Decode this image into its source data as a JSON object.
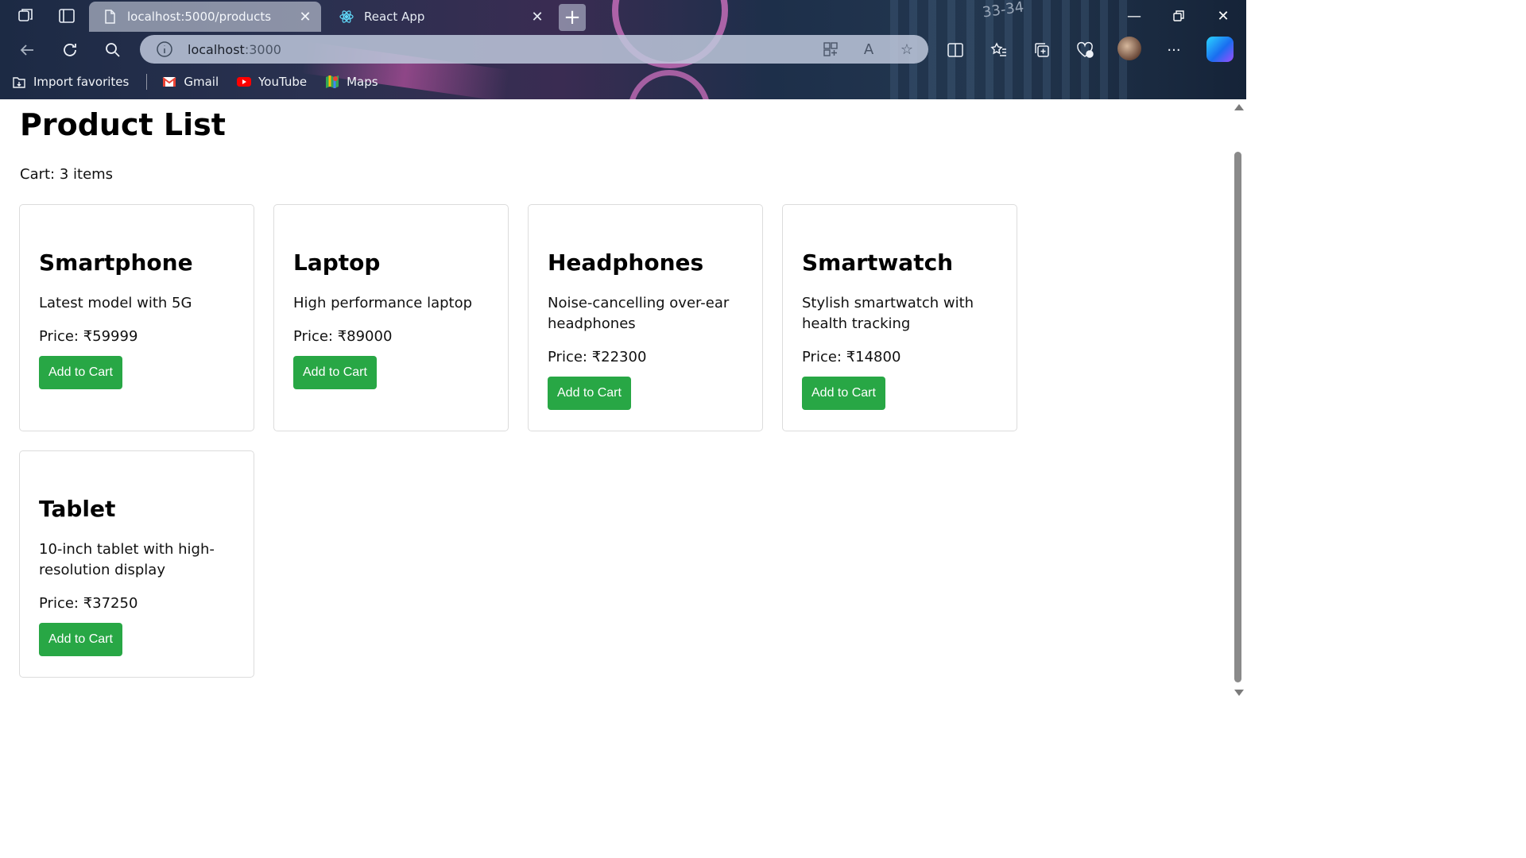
{
  "browser": {
    "tabs": [
      {
        "title": "localhost:5000/products",
        "active": true,
        "icon": "page-icon"
      },
      {
        "title": "React App",
        "active": false,
        "icon": "react-icon"
      }
    ],
    "address_url_host": "localhost",
    "address_url_port": ":3000",
    "bookmarks": [
      {
        "label": "Import favorites",
        "icon": "import-favorites-icon"
      },
      {
        "label": "Gmail",
        "icon": "gmail-icon"
      },
      {
        "label": "YouTube",
        "icon": "youtube-icon"
      },
      {
        "label": "Maps",
        "icon": "maps-icon"
      }
    ],
    "wallpaper_text": "33-34"
  },
  "page": {
    "title": "Product List",
    "cart_text": "Cart: 3 items",
    "products": [
      {
        "name": "Smartphone",
        "description": "Latest model with 5G",
        "price": "Price: ₹59999",
        "button": "Add to Cart"
      },
      {
        "name": "Laptop",
        "description": "High performance laptop",
        "price": "Price: ₹89000",
        "button": "Add to Cart"
      },
      {
        "name": "Headphones",
        "description": "Noise-cancelling over-ear headphones",
        "price": "Price: ₹22300",
        "button": "Add to Cart"
      },
      {
        "name": "Smartwatch",
        "description": "Stylish smartwatch with health tracking",
        "price": "Price: ₹14800",
        "button": "Add to Cart"
      },
      {
        "name": "Tablet",
        "description": "10-inch tablet with high-resolution display",
        "price": "Price: ₹37250",
        "button": "Add to Cart"
      }
    ]
  },
  "colors": {
    "button": "#28a745",
    "card_border": "#dcdcdc"
  }
}
